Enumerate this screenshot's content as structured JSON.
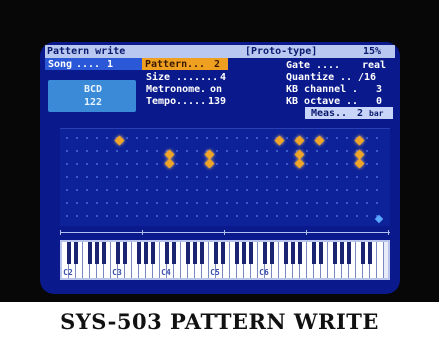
{
  "window": {
    "title": "Pattern write",
    "mode": "[Proto-type]",
    "percent": "15%"
  },
  "song": {
    "label": "Song",
    "value": "1"
  },
  "status_block": {
    "line1": "BCD",
    "line2": "122"
  },
  "params_left": [
    {
      "label": "Pattern",
      "value": "2"
    },
    {
      "label": "Size",
      "value": "4"
    },
    {
      "label": "Metronome",
      "value": "on"
    },
    {
      "label": "Tempo",
      "value": "139"
    }
  ],
  "params_right": [
    {
      "label": "Gate",
      "value": "real"
    },
    {
      "label": "Quantize",
      "value": "/16"
    },
    {
      "label": "KB channel",
      "value": "3"
    },
    {
      "label": "KB octave",
      "value": "0"
    }
  ],
  "measure": {
    "label": "Meas",
    "value": "2",
    "unit": "bar"
  },
  "keyboard": {
    "octave_labels": [
      "C2",
      "C3",
      "C4",
      "C5",
      "C6"
    ]
  },
  "caption": "SYS-503 PATTERN WRITE",
  "colors": {
    "screen_bg": "#0a1a8c",
    "title_bg": "#b9c8f0",
    "pattern_highlight": "#f0a020",
    "note": "#f0a428",
    "song_bar": "#2b58d6"
  }
}
